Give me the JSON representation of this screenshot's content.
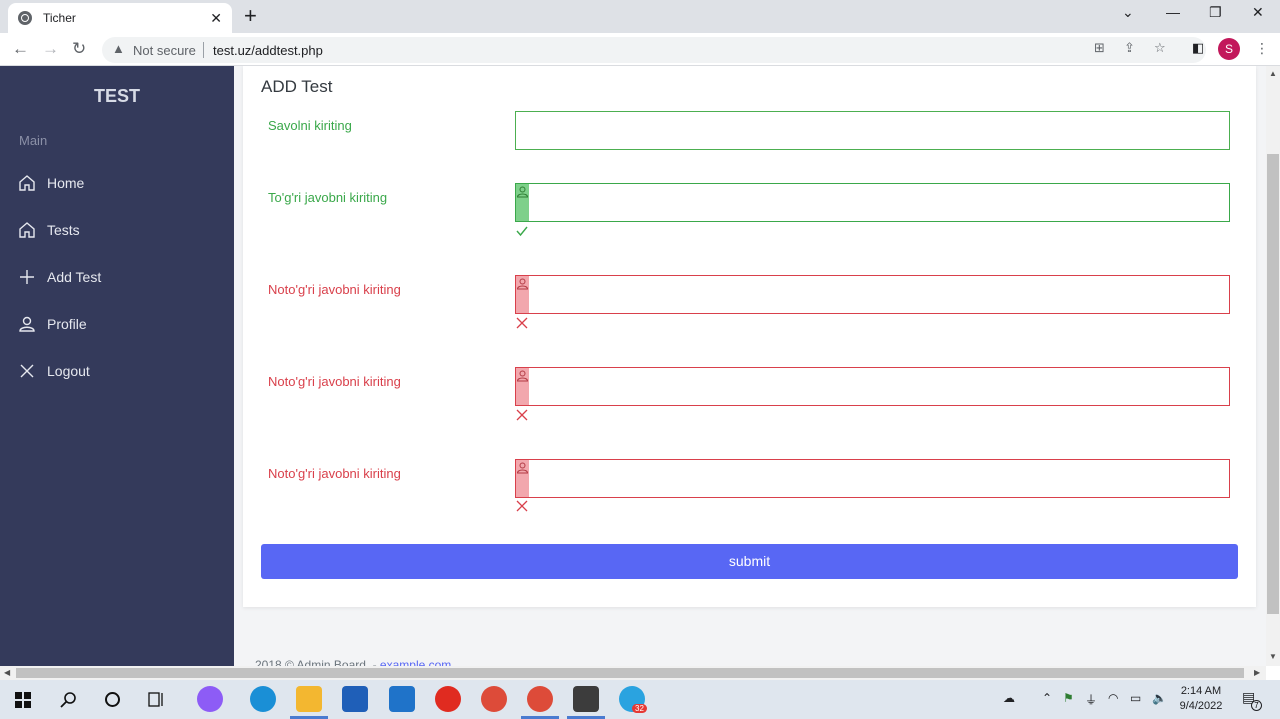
{
  "browser": {
    "tab_title": "Ticher",
    "new_tab": "+",
    "security_label": "Not secure",
    "url": "test.uz/addtest.php",
    "profile_initial": "S"
  },
  "sidebar": {
    "brand": "TEST",
    "section": "Main",
    "items": [
      {
        "label": "Home",
        "icon": "home-icon"
      },
      {
        "label": "Tests",
        "icon": "home-icon"
      },
      {
        "label": "Add Test",
        "icon": "plus-icon"
      },
      {
        "label": "Profile",
        "icon": "user-icon"
      },
      {
        "label": "Logout",
        "icon": "close-icon"
      }
    ]
  },
  "form": {
    "title": "ADD Test",
    "fields": [
      {
        "label": "Savolni kiriting",
        "value": "",
        "state": "neutral"
      },
      {
        "label": "To'g'ri javobni kiriting",
        "value": "",
        "state": "valid"
      },
      {
        "label": "Noto'g'ri javobni kiriting",
        "value": "",
        "state": "invalid"
      },
      {
        "label": "Noto'g'ri javobni kiriting",
        "value": "",
        "state": "invalid"
      },
      {
        "label": "Noto'g'ri javobni kiriting",
        "value": "",
        "state": "invalid"
      }
    ],
    "submit_label": "submit"
  },
  "footer": {
    "text": "2018 © Admin Board. - ",
    "link": "example.com"
  },
  "taskbar": {
    "time": "2:14 AM",
    "date": "9/4/2022",
    "telegram_badge": "32",
    "notification_count": "7"
  },
  "colors": {
    "sidebar_bg": "#343a5b",
    "valid": "#3aa84a",
    "invalid": "#d9404b",
    "submit": "#5867f4"
  }
}
